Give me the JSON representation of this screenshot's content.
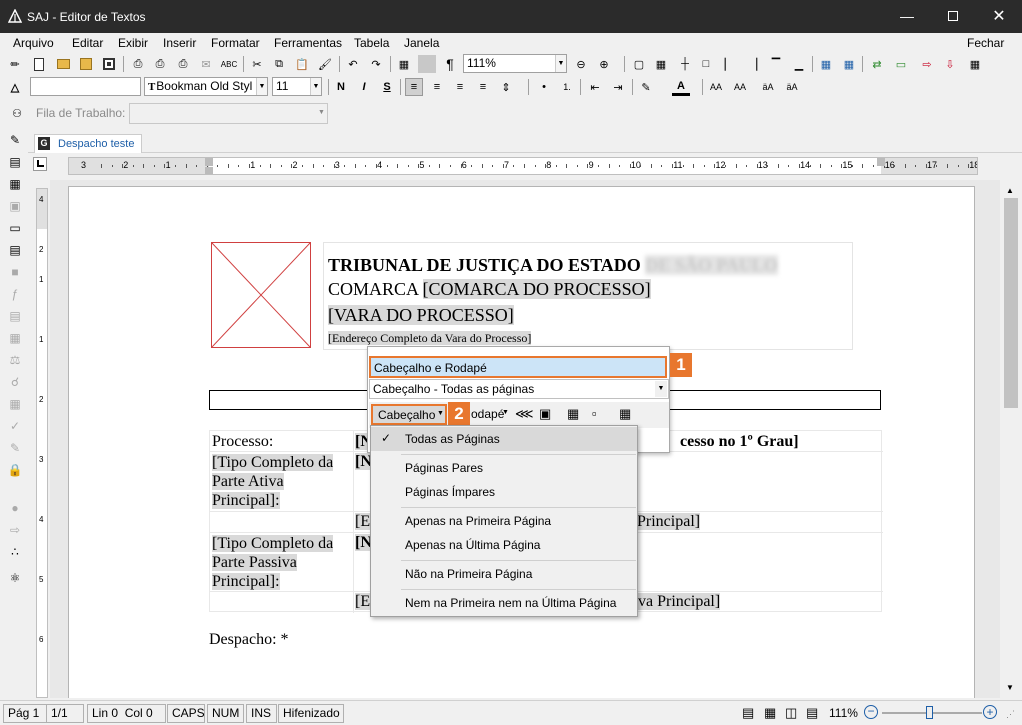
{
  "app": {
    "title": "SAJ - Editor de Textos"
  },
  "menubar": {
    "items": [
      "Arquivo",
      "Editar",
      "Exibir",
      "Inserir",
      "Formatar",
      "Ferramentas",
      "Tabela",
      "Janela"
    ],
    "close_label": "Fechar"
  },
  "toolbar1": {
    "zoom": "111%"
  },
  "toolbar2": {
    "font": "Bookman Old Styl",
    "size": "11",
    "style_value": ""
  },
  "workspace": {
    "label": "Fila de Trabalho:",
    "value": ""
  },
  "tabs": [
    {
      "label": "Despacho teste"
    }
  ],
  "ruler": {
    "numbers": [
      "3",
      "2",
      "1",
      "1",
      "2",
      "3",
      "4",
      "5",
      "6",
      "7",
      "8",
      "9",
      "10",
      "11",
      "12",
      "13",
      "14",
      "15",
      "16",
      "17",
      "18"
    ]
  },
  "doc": {
    "header_line1": "TRIBUNAL DE JUSTIÇA DO ESTADO",
    "header_line1_blur": "DE SÃO PAULO",
    "header_line2_prefix": "COMARCA ",
    "header_line2_field": "[COMARCA DO PROCESSO]",
    "header_line3": "[VARA DO PROCESSO]",
    "header_line4": "[Endereço Completo da Vara do Processo]",
    "processo_label": "Processo:",
    "processo_value_start": "[N",
    "processo_value_end": "cesso no 1º Grau]",
    "parte_ativa_label": "[Tipo Completo da Parte Ativa Principal]:",
    "parte_ativa_value": "[N",
    "endereco_ativa_start": "[E",
    "endereco_ativa_end": "Principal]",
    "parte_passiva_label": "[Tipo Completo da Parte Passiva Principal]:",
    "parte_passiva_value": "[N",
    "endereco_passiva_start": "[E",
    "endereco_passiva_end": "va Principal]",
    "despacho": "Despacho: *"
  },
  "header_popup": {
    "title": "Cabeçalho e Rodapé",
    "dropdown": "Cabeçalho -  Todas as páginas",
    "cabecalho_button": "Cabeçalho",
    "rodape_button": "odapé"
  },
  "dropdown_menu": {
    "items": [
      {
        "label": "Todas as Páginas",
        "checked": true
      },
      {
        "label": "Páginas Pares",
        "checked": false
      },
      {
        "label": "Páginas Ímpares",
        "checked": false
      },
      {
        "label": "Apenas na Primeira Página",
        "checked": false
      },
      {
        "label": "Apenas na Última Página",
        "checked": false
      },
      {
        "label": "Não na Primeira Página",
        "checked": false
      },
      {
        "label": "Nem na Primeira nem na Última Página",
        "checked": false
      }
    ]
  },
  "badges": {
    "one": "1",
    "two": "2"
  },
  "status": {
    "page": "Pág 1",
    "pages": "1/1",
    "position": "Lin 0  Col 0",
    "caps": "CAPS",
    "num": "NUM",
    "ins": "INS",
    "hyphen": "Hifenizado",
    "zoom": "111%"
  },
  "colors": {
    "accent": "#e8772e",
    "titlebar": "#2b2b2b",
    "tab_text": "#1e5fa8",
    "popup_highlight": "#cce4f7"
  }
}
